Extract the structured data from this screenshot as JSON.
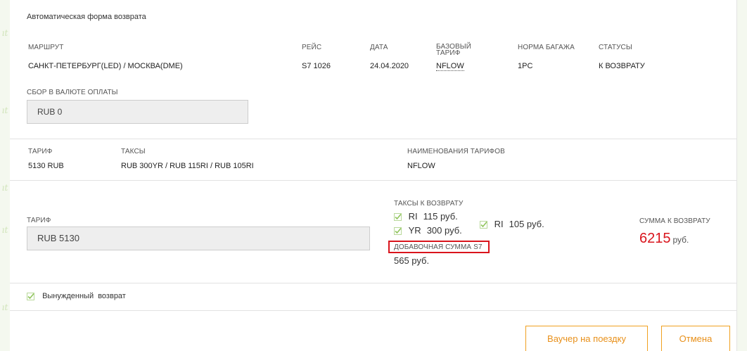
{
  "form_title": "Автоматическая форма возврата",
  "flight_table": {
    "headers": {
      "route": "МАРШРУТ",
      "flight": "РЕЙС",
      "date": "ДАТА",
      "base_fare_line1": "БАЗОВЫЙ",
      "base_fare_line2": "ТАРИФ",
      "baggage": "НОРМА БАГАЖА",
      "status": "СТАТУСЫ"
    },
    "row": {
      "route": "САНКТ-ПЕТЕРБУРГ(LED) / МОСКВА(DME)",
      "flight": "S7 1026",
      "date": "24.04.2020",
      "base_fare": "NFLOW",
      "baggage": "1PC",
      "status": "К ВОЗВРАТУ"
    }
  },
  "fee": {
    "label": "СБОР В ВАЛЮТЕ ОПЛАТЫ",
    "value": "RUB 0"
  },
  "fare_info": {
    "tariff_label": "ТАРИФ",
    "tariff_value": "5130 RUB",
    "taxes_label": "ТАКСЫ",
    "taxes_value": "RUB 300YR / RUB 115RI / RUB 105RI",
    "fare_names_label": "НАИМЕНОВАНИЯ ТАРИФОВ",
    "fare_names_value": "NFLOW"
  },
  "refund": {
    "tariff_label": "ТАРИФ",
    "tariff_value": "RUB 5130",
    "taxes_label": "ТАКСЫ К ВОЗВРАТУ",
    "taxes": [
      {
        "code": "RI",
        "amount": "115 руб.",
        "checked": true
      },
      {
        "code": "YR",
        "amount": "300 руб.",
        "checked": true
      },
      {
        "code": "RI",
        "amount": "105 руб.",
        "checked": true
      }
    ],
    "additional_label": "ДОБАВОЧНАЯ СУММА S7",
    "additional_value": "565 руб.",
    "sum_label": "СУММА К ВОЗВРАТУ",
    "sum_value": "6215",
    "sum_unit": "руб."
  },
  "forced_refund": {
    "label": "Вынужденный  возврат",
    "checked": true
  },
  "buttons": {
    "voucher": "Ваучер на поездку",
    "cancel": "Отмена"
  },
  "colors": {
    "accent_orange": "#f0a020",
    "sum_red": "#d9141c",
    "check_green": "#8fc45a"
  }
}
